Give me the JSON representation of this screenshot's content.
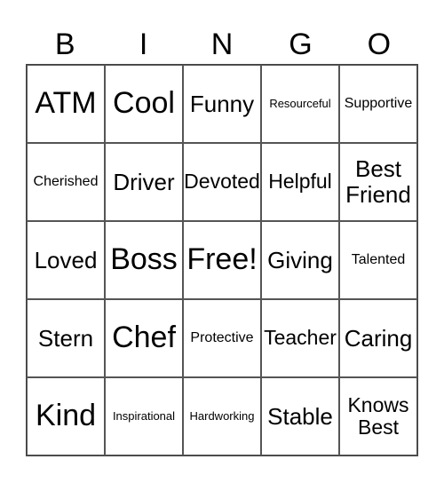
{
  "header": [
    "B",
    "I",
    "N",
    "G",
    "O"
  ],
  "cells": [
    {
      "text": "ATM",
      "size": "xl"
    },
    {
      "text": "Cool",
      "size": "xl"
    },
    {
      "text": "Funny",
      "size": "l"
    },
    {
      "text": "Resourceful",
      "size": "xs"
    },
    {
      "text": "Supportive",
      "size": "s"
    },
    {
      "text": "Cherished",
      "size": "s"
    },
    {
      "text": "Driver",
      "size": "l"
    },
    {
      "text": "Devoted",
      "size": "m"
    },
    {
      "text": "Helpful",
      "size": "m"
    },
    {
      "text": "Best Friend",
      "size": "l"
    },
    {
      "text": "Loved",
      "size": "l"
    },
    {
      "text": "Boss",
      "size": "xl"
    },
    {
      "text": "Free!",
      "size": "xl"
    },
    {
      "text": "Giving",
      "size": "l"
    },
    {
      "text": "Talented",
      "size": "s"
    },
    {
      "text": "Stern",
      "size": "l"
    },
    {
      "text": "Chef",
      "size": "xl"
    },
    {
      "text": "Protective",
      "size": "s"
    },
    {
      "text": "Teacher",
      "size": "m"
    },
    {
      "text": "Caring",
      "size": "l"
    },
    {
      "text": "Kind",
      "size": "xl"
    },
    {
      "text": "Inspirational",
      "size": "xs"
    },
    {
      "text": "Hardworking",
      "size": "xs"
    },
    {
      "text": "Stable",
      "size": "l"
    },
    {
      "text": "Knows Best",
      "size": "m"
    }
  ]
}
